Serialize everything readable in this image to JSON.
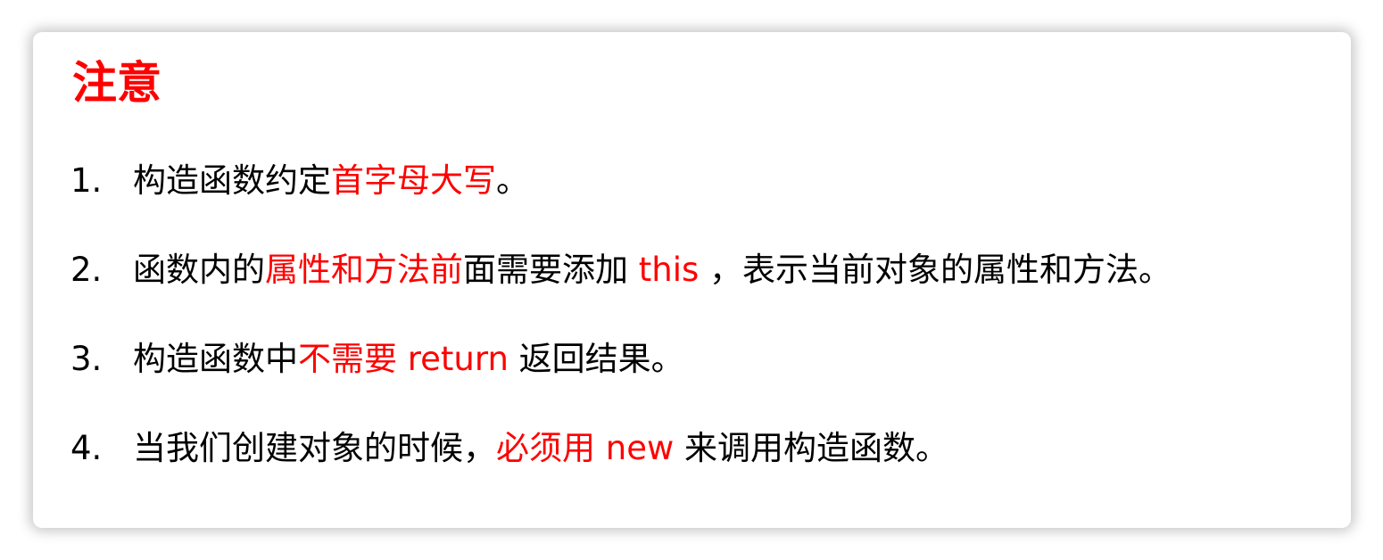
{
  "title": "注意",
  "colors": {
    "highlight": "#ff0000",
    "text": "#000000"
  },
  "items": [
    {
      "number": "1.",
      "segments": [
        {
          "text": "构造函数约定"
        },
        {
          "text": "首字母大写"
        },
        {
          "text": "。"
        }
      ]
    },
    {
      "number": "2.",
      "segments": [
        {
          "text": "函数内的"
        },
        {
          "text": "属性和方法前"
        },
        {
          "text": "面需要添加 "
        },
        {
          "text": "this"
        },
        {
          "text": " ，表示当前对象的属性和方法。"
        }
      ]
    },
    {
      "number": "3.",
      "segments": [
        {
          "text": "构造函数中"
        },
        {
          "text": "不需要 return"
        },
        {
          "text": " 返回结果。"
        }
      ]
    },
    {
      "number": "4.",
      "segments": [
        {
          "text": "当我们创建对象的时候，"
        },
        {
          "text": "必须用 new"
        },
        {
          "text": " 来调用构造函数。"
        }
      ]
    }
  ]
}
